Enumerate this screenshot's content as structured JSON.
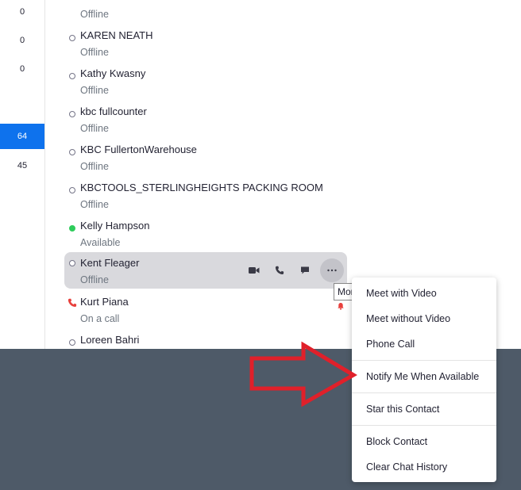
{
  "left_counts": [
    "0",
    "0",
    "0",
    "64",
    "45"
  ],
  "contacts": [
    {
      "name": "",
      "sub": "Offline",
      "status": "offline"
    },
    {
      "name": "KAREN NEATH",
      "sub": "Offline",
      "status": "offline"
    },
    {
      "name": "Kathy Kwasny",
      "sub": "Offline",
      "status": "offline"
    },
    {
      "name": "kbc fullcounter",
      "sub": "Offline",
      "status": "offline"
    },
    {
      "name": "KBC FullertonWarehouse",
      "sub": "Offline",
      "status": "offline"
    },
    {
      "name": "KBCTOOLS_STERLINGHEIGHTS PACKING ROOM",
      "sub": "Offline",
      "status": "offline"
    },
    {
      "name": "Kelly Hampson",
      "sub": "Available",
      "status": "available"
    },
    {
      "name": "Kent Fleager",
      "sub": "Offline",
      "status": "offline"
    },
    {
      "name": "Kurt Piana",
      "sub": "On a call",
      "status": "oncall"
    },
    {
      "name": "Loreen Bahri",
      "sub": "",
      "status": "offline"
    }
  ],
  "tooltip": "More",
  "menu": {
    "items": [
      "Meet with Video",
      "Meet without Video",
      "Phone Call",
      "Notify Me When Available",
      "Star this Contact",
      "Block Contact",
      "Clear Chat History"
    ]
  },
  "colors": {
    "accent": "#0e72ed",
    "available": "#2ecc5b",
    "oncall": "#e8403c",
    "arrow": "#e0202a",
    "dark_background": "#4e5a68"
  }
}
